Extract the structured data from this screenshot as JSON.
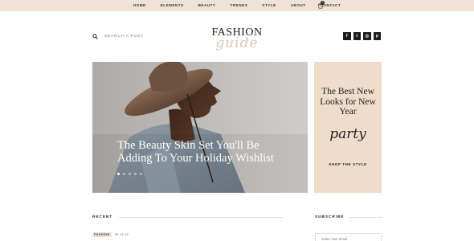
{
  "nav": {
    "items": [
      "HOME",
      "ELEMENTS",
      "BEAUTY",
      "TRENDS",
      "STYLE",
      "ABOUT",
      "CONTACT"
    ],
    "cart_icon": "shopping-bag-icon",
    "cart_count": "0"
  },
  "search": {
    "icon": "search-icon",
    "placeholder": "SEARCH A POST"
  },
  "logo": {
    "main": "FASHION",
    "script": "guide"
  },
  "social": {
    "items": [
      "f",
      "t",
      "◎",
      "p"
    ],
    "icons": [
      "facebook-icon",
      "twitter-icon",
      "instagram-icon",
      "pinterest-icon"
    ]
  },
  "hero": {
    "title": "The Beauty Skin Set You'll Be Adding To Your Holiday Wishlist",
    "slide_count": 5,
    "active_slide": 1
  },
  "promo": {
    "title": "The Best New Looks for New Year",
    "script": "party",
    "link": "SHOP THE STYLE"
  },
  "recent": {
    "label": "RECENT",
    "first_post": {
      "category": "FASHION",
      "date": "09.12.18"
    }
  },
  "subscribe": {
    "label": "SUBSCRIBE",
    "placeholder": "Enter Your Email"
  },
  "colors": {
    "topbar": "#efe3d7",
    "promo_bg": "#efdcca",
    "accent_text": "#222222"
  }
}
